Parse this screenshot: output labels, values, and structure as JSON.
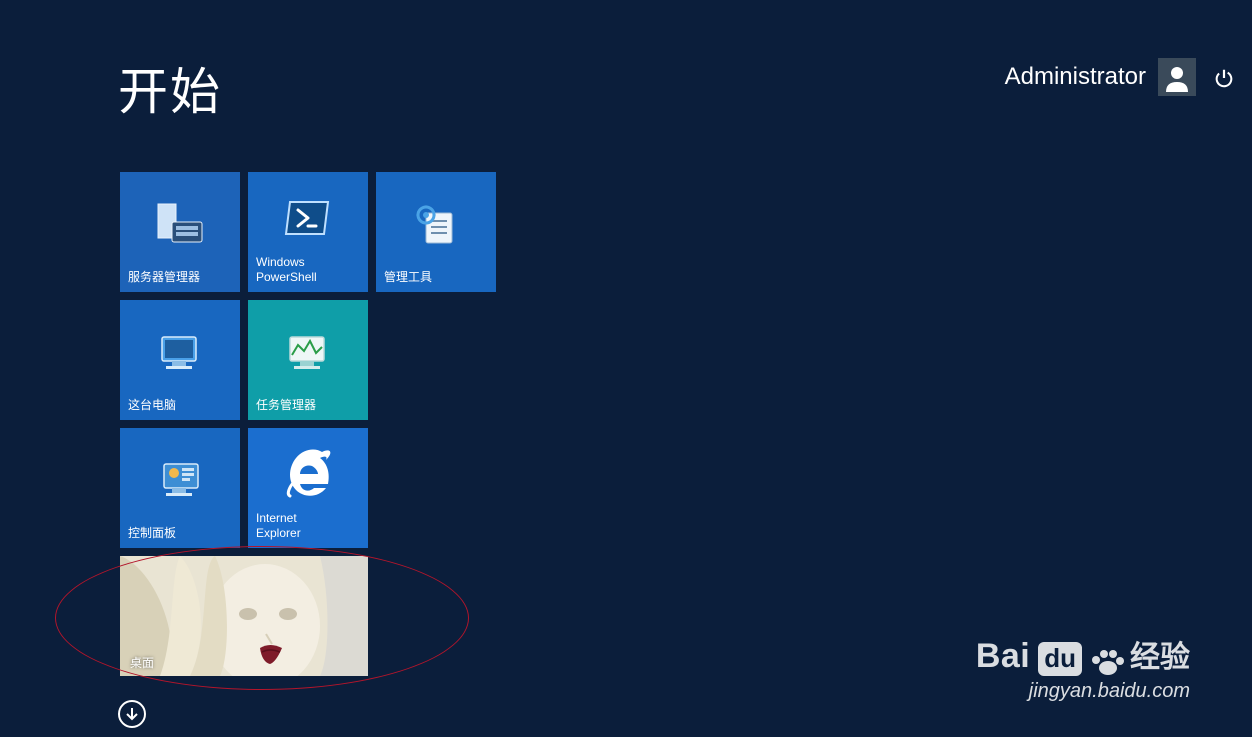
{
  "header": {
    "title": "开始",
    "username": "Administrator"
  },
  "tiles": [
    {
      "id": "server-manager",
      "label": "服务器管理器",
      "color": "c-blue1",
      "icon": "server-manager-icon"
    },
    {
      "id": "powershell",
      "label": "Windows\nPowerShell",
      "color": "c-blue2",
      "icon": "powershell-icon"
    },
    {
      "id": "admin-tools",
      "label": "管理工具",
      "color": "c-blue2",
      "icon": "admin-tools-icon"
    },
    {
      "id": "this-pc",
      "label": "这台电脑",
      "color": "c-blue2",
      "icon": "this-pc-icon"
    },
    {
      "id": "task-manager",
      "label": "任务管理器",
      "color": "c-teal",
      "icon": "task-manager-icon"
    },
    {
      "id": "spacer",
      "label": "",
      "color": "",
      "icon": "",
      "empty": true
    },
    {
      "id": "control-panel",
      "label": "控制面板",
      "color": "c-blue2",
      "icon": "control-panel-icon"
    },
    {
      "id": "internet-explorer",
      "label": "Internet\nExplorer",
      "color": "c-blue3",
      "icon": "ie-icon"
    },
    {
      "id": "spacer2",
      "label": "",
      "color": "",
      "icon": "",
      "empty": true
    },
    {
      "id": "desktop",
      "label": "桌面",
      "color": "",
      "icon": "desktop-icon",
      "wide": true
    }
  ],
  "watermark": {
    "brand_prefix": "Bai",
    "brand_box": "du",
    "brand_suffix": "经验",
    "url": "jingyan.baidu.com"
  }
}
